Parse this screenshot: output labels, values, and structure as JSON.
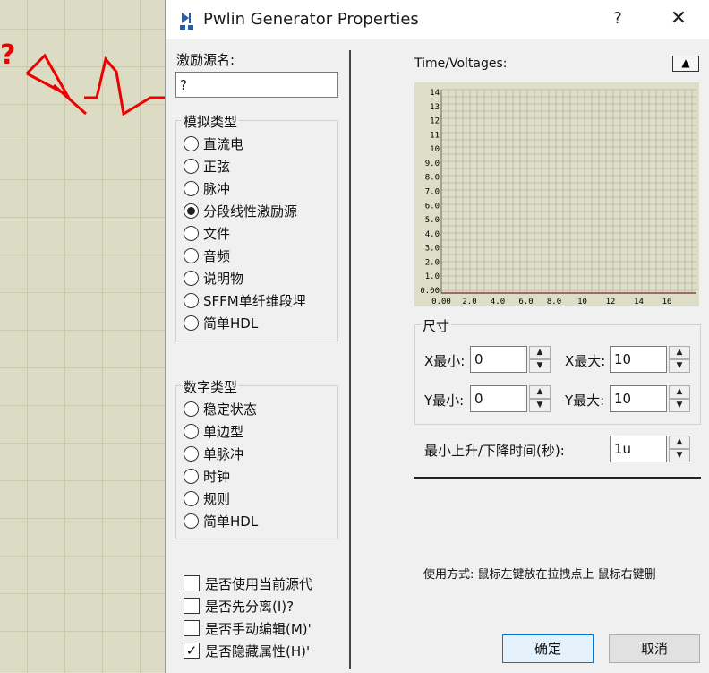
{
  "schematic": {
    "marker": "?"
  },
  "dialog": {
    "title": "Pwlin Generator Properties",
    "help": "?",
    "close": "✕"
  },
  "source_name": {
    "label": "激励源名:",
    "value": "?"
  },
  "analog": {
    "title": "模拟类型",
    "options": [
      "直流电",
      "正弦",
      "脉冲",
      "分段线性激励源",
      "文件",
      "音频",
      "说明物",
      "SFFM单纤维段埋",
      "简单HDL"
    ],
    "selected_index": 3
  },
  "digital": {
    "title": "数字类型",
    "options": [
      "稳定状态",
      "单边型",
      "单脉冲",
      "时钟",
      "规则",
      "简单HDL"
    ]
  },
  "checks": [
    {
      "label": "是否使用当前源代",
      "checked": false
    },
    {
      "label": "是否先分离(I)?",
      "checked": false
    },
    {
      "label": "是否手动编辑(M)'",
      "checked": false
    },
    {
      "label": "是否隐藏属性(H)'",
      "checked": true
    }
  ],
  "graph": {
    "label": "Time/Voltages:",
    "collapse_glyph": "▲",
    "y_ticks": [
      "14",
      "13",
      "12",
      "11",
      "10",
      "9.0",
      "8.0",
      "7.0",
      "6.0",
      "5.0",
      "4.0",
      "3.0",
      "2.0",
      "1.0",
      "0.00"
    ],
    "x_ticks": [
      "0.00",
      "2.0",
      "4.0",
      "6.0",
      "8.0",
      "10",
      "12",
      "14",
      "16"
    ],
    "colors": {
      "bg": "#dedec8",
      "grid": "#bcbcaa",
      "trace": "#cc0000"
    }
  },
  "size": {
    "title": "尺寸",
    "xmin_label": "X最小:",
    "xmin": "0",
    "xmax_label": "X最大:",
    "xmax": "10",
    "ymin_label": "Y最小:",
    "ymin": "0",
    "ymax_label": "Y最大:",
    "ymax": "10"
  },
  "rise_fall": {
    "label": "最小上升/下降时间(秒):",
    "value": "1u"
  },
  "usage": "使用方式: 鼠标左键放在拉拽点上 鼠标右键删",
  "buttons": {
    "ok": "确定",
    "cancel": "取消"
  }
}
